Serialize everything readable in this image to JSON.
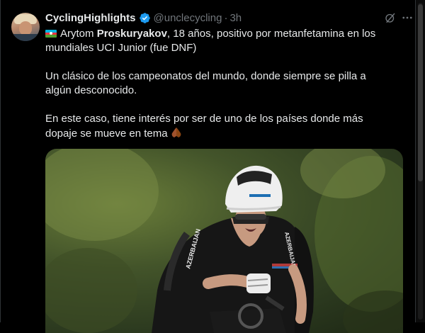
{
  "tweet": {
    "display_name": "CyclingHighlights",
    "handle": "@unclecycling",
    "separator": "·",
    "time": "3h",
    "line1_before": "Arytom ",
    "line1_bold": "Proskuryakov",
    "line1_after": ", 18 años, positivo por metanfetamina en los mundiales UCI Junior (fue DNF)",
    "paragraph2": "Un clásico de los campeonatos del mundo, donde siempre se pilla a algún desconocido.",
    "paragraph3": "En este caso, tiene interés por ser de uno de los países donde más dopaje se mueve en tema",
    "flag_icon": "azerbaijan-flag-icon",
    "end_emoji": "folded-hands-icon",
    "jersey_text": "AZERBAIJAN",
    "jersey_sleeve_text": "AZERBAIJAN"
  },
  "colors": {
    "background": "#000000",
    "text": "#e7e9ea",
    "muted": "#71767b",
    "verified": "#1d9bf0"
  }
}
